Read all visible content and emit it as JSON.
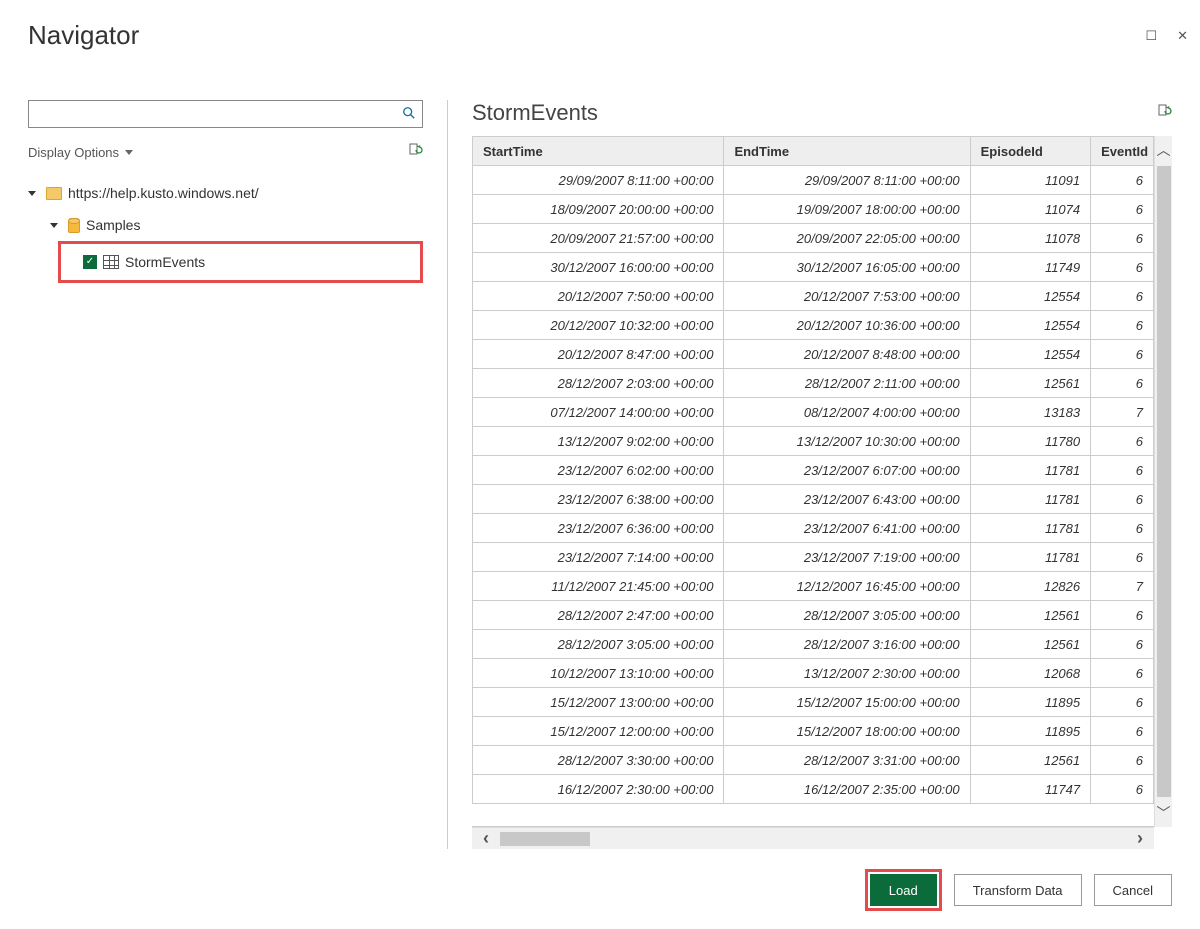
{
  "window": {
    "title": "Navigator",
    "maximize": "☐",
    "close": "✕"
  },
  "left": {
    "displayOptions": "Display Options",
    "tree": {
      "root": "https://help.kusto.windows.net/",
      "db": "Samples",
      "table": "StormEvents"
    }
  },
  "preview": {
    "title": "StormEvents",
    "columns": [
      "StartTime",
      "EndTime",
      "EpisodeId",
      "EventId"
    ],
    "rows": [
      {
        "start": "29/09/2007 8:11:00 +00:00",
        "end": "29/09/2007 8:11:00 +00:00",
        "episode": "11091",
        "event": "6"
      },
      {
        "start": "18/09/2007 20:00:00 +00:00",
        "end": "19/09/2007 18:00:00 +00:00",
        "episode": "11074",
        "event": "6"
      },
      {
        "start": "20/09/2007 21:57:00 +00:00",
        "end": "20/09/2007 22:05:00 +00:00",
        "episode": "11078",
        "event": "6"
      },
      {
        "start": "30/12/2007 16:00:00 +00:00",
        "end": "30/12/2007 16:05:00 +00:00",
        "episode": "11749",
        "event": "6"
      },
      {
        "start": "20/12/2007 7:50:00 +00:00",
        "end": "20/12/2007 7:53:00 +00:00",
        "episode": "12554",
        "event": "6"
      },
      {
        "start": "20/12/2007 10:32:00 +00:00",
        "end": "20/12/2007 10:36:00 +00:00",
        "episode": "12554",
        "event": "6"
      },
      {
        "start": "20/12/2007 8:47:00 +00:00",
        "end": "20/12/2007 8:48:00 +00:00",
        "episode": "12554",
        "event": "6"
      },
      {
        "start": "28/12/2007 2:03:00 +00:00",
        "end": "28/12/2007 2:11:00 +00:00",
        "episode": "12561",
        "event": "6"
      },
      {
        "start": "07/12/2007 14:00:00 +00:00",
        "end": "08/12/2007 4:00:00 +00:00",
        "episode": "13183",
        "event": "7"
      },
      {
        "start": "13/12/2007 9:02:00 +00:00",
        "end": "13/12/2007 10:30:00 +00:00",
        "episode": "11780",
        "event": "6"
      },
      {
        "start": "23/12/2007 6:02:00 +00:00",
        "end": "23/12/2007 6:07:00 +00:00",
        "episode": "11781",
        "event": "6"
      },
      {
        "start": "23/12/2007 6:38:00 +00:00",
        "end": "23/12/2007 6:43:00 +00:00",
        "episode": "11781",
        "event": "6"
      },
      {
        "start": "23/12/2007 6:36:00 +00:00",
        "end": "23/12/2007 6:41:00 +00:00",
        "episode": "11781",
        "event": "6"
      },
      {
        "start": "23/12/2007 7:14:00 +00:00",
        "end": "23/12/2007 7:19:00 +00:00",
        "episode": "11781",
        "event": "6"
      },
      {
        "start": "11/12/2007 21:45:00 +00:00",
        "end": "12/12/2007 16:45:00 +00:00",
        "episode": "12826",
        "event": "7"
      },
      {
        "start": "28/12/2007 2:47:00 +00:00",
        "end": "28/12/2007 3:05:00 +00:00",
        "episode": "12561",
        "event": "6"
      },
      {
        "start": "28/12/2007 3:05:00 +00:00",
        "end": "28/12/2007 3:16:00 +00:00",
        "episode": "12561",
        "event": "6"
      },
      {
        "start": "10/12/2007 13:10:00 +00:00",
        "end": "13/12/2007 2:30:00 +00:00",
        "episode": "12068",
        "event": "6"
      },
      {
        "start": "15/12/2007 13:00:00 +00:00",
        "end": "15/12/2007 15:00:00 +00:00",
        "episode": "11895",
        "event": "6"
      },
      {
        "start": "15/12/2007 12:00:00 +00:00",
        "end": "15/12/2007 18:00:00 +00:00",
        "episode": "11895",
        "event": "6"
      },
      {
        "start": "28/12/2007 3:30:00 +00:00",
        "end": "28/12/2007 3:31:00 +00:00",
        "episode": "12561",
        "event": "6"
      },
      {
        "start": "16/12/2007 2:30:00 +00:00",
        "end": "16/12/2007 2:35:00 +00:00",
        "episode": "11747",
        "event": "6"
      }
    ]
  },
  "footer": {
    "load": "Load",
    "transform": "Transform Data",
    "cancel": "Cancel"
  }
}
